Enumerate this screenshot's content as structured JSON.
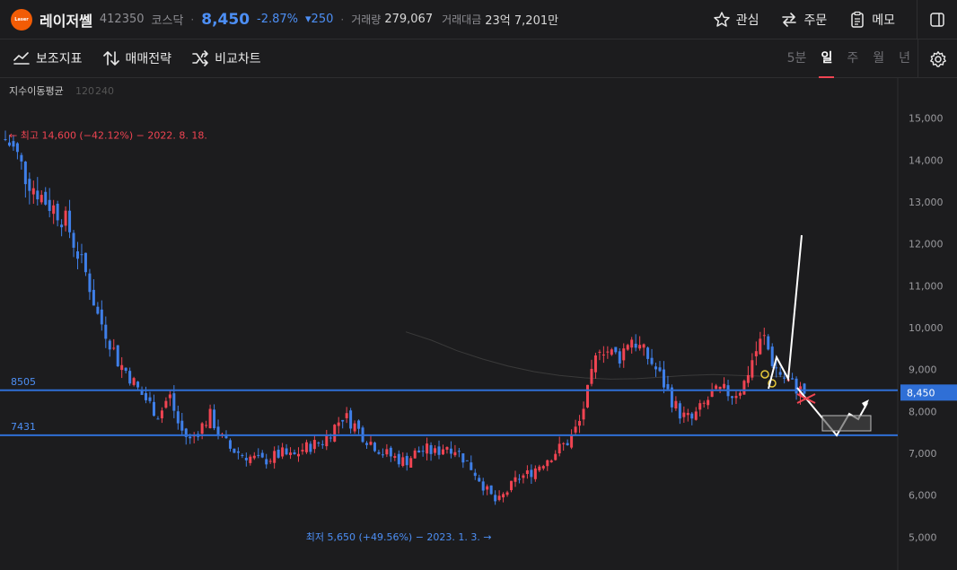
{
  "header": {
    "logo_text": "Laser",
    "name": "레이저쎌",
    "code": "412350",
    "market": "코스닥",
    "price": "8,450",
    "change_pct": "-2.87%",
    "change_abs": "▾250",
    "volume_label": "거래량",
    "volume": "279,067",
    "amount_label": "거래대금",
    "amount": "23억 7,201만"
  },
  "actions": {
    "watch": "관심",
    "order": "주문",
    "memo": "메모"
  },
  "toolbar": {
    "indicator": "보조지표",
    "strategy": "매매전략",
    "compare": "비교차트"
  },
  "periods": [
    "5분",
    "일",
    "주",
    "월",
    "년"
  ],
  "active_period": "일",
  "colors": {
    "up": "#f04452",
    "down": "#3f7fe8",
    "accent": "#2f6fd6",
    "ma": "#3a3a3a"
  },
  "chart_data": {
    "type": "candlestick",
    "ma_label": "지수이동평균",
    "ma_periods": [
      "120",
      "240"
    ],
    "y_ticks": [
      "15,000",
      "14,000",
      "13,000",
      "12,000",
      "11,000",
      "10,000",
      "9,000",
      "8,000",
      "7,000",
      "6,000",
      "5,000"
    ],
    "ylim": [
      4600,
      15400
    ],
    "high_label": "← 최고 14,600 (−42.12%) − 2022. 8. 18.",
    "low_label": "최저 5,650 (+49.56%) − 2023. 1. 3. →",
    "current_price_label": "8,450",
    "current_price": 8450,
    "levels": [
      {
        "label": "8505",
        "value": 8505
      },
      {
        "label": "7431",
        "value": 7431
      }
    ],
    "close_path": [
      14500,
      14200,
      13600,
      13300,
      13000,
      12800,
      12500,
      11800,
      11200,
      10300,
      9800,
      9200,
      8900,
      8500,
      8200,
      7900,
      8400,
      7600,
      7300,
      7600,
      7900,
      7400,
      7100,
      7000,
      6900,
      6800,
      6900,
      7000,
      6900,
      7100,
      7200,
      7300,
      7600,
      7900,
      7700,
      7400,
      7200,
      7000,
      6900,
      6800,
      7000,
      7100,
      7000,
      7200,
      7100,
      6800,
      6500,
      6100,
      5800,
      6100,
      6400,
      6500,
      6700,
      6900,
      7100,
      7300,
      7700,
      8600,
      9600,
      9400,
      9300,
      9800,
      9500,
      9200,
      8800,
      8300,
      7900,
      7800,
      8100,
      8400,
      8500,
      8400,
      8600,
      9300,
      9800,
      9100,
      8800,
      8600,
      8450
    ],
    "ma_series": [
      9900,
      9700,
      9450,
      9250,
      9080,
      8950,
      8860,
      8800,
      8770,
      8780,
      8820,
      8860,
      8880,
      8860,
      8840,
      8830
    ]
  }
}
